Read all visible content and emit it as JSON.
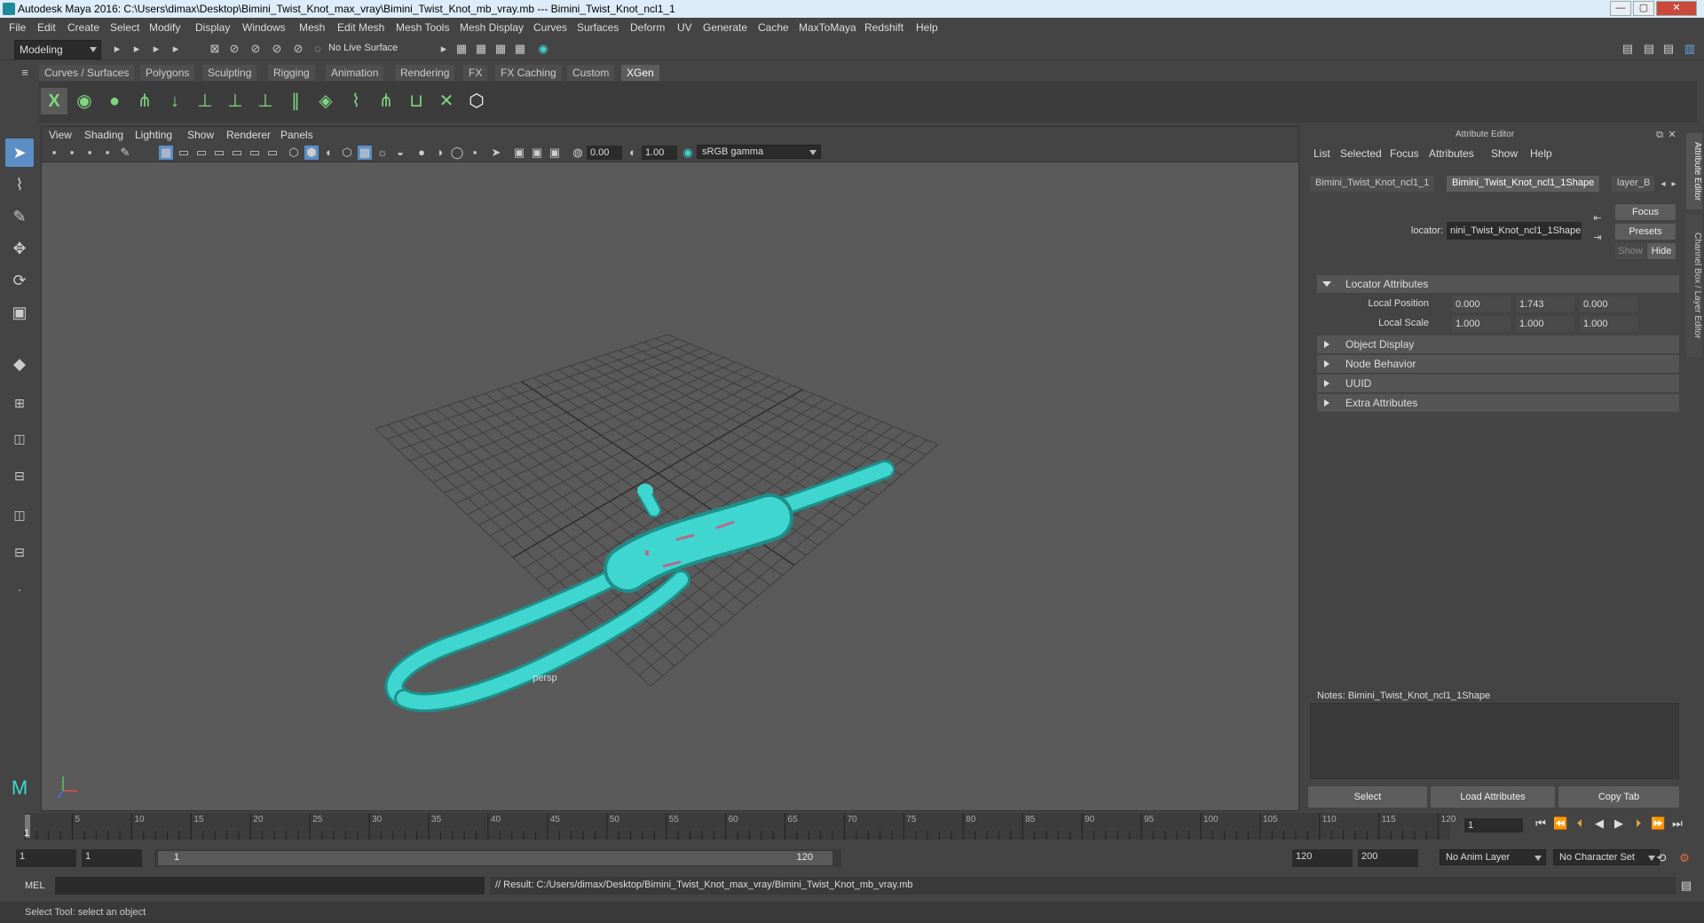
{
  "title_bar": {
    "text": "Autodesk Maya 2016: C:\\Users\\dimax\\Desktop\\Bimini_Twist_Knot_max_vray\\Bimini_Twist_Knot_mb_vray.mb   ---   Bimini_Twist_Knot_ncl1_1",
    "minimize": "—",
    "maximize": "▢",
    "close": "✕"
  },
  "menu": [
    "File",
    "Edit",
    "Create",
    "Select",
    "Modify",
    "Display",
    "Windows",
    "Mesh",
    "Edit Mesh",
    "Mesh Tools",
    "Mesh Display",
    "Curves",
    "Surfaces",
    "Deform",
    "UV",
    "Generate",
    "Cache",
    "MaxToMaya",
    "Redshift",
    "Help"
  ],
  "status_line": {
    "mode": "Modeling",
    "live_surface": "No Live Surface"
  },
  "shelf_tabs": [
    "Curves / Surfaces",
    "Polygons",
    "Sculpting",
    "Rigging",
    "Animation",
    "Rendering",
    "FX",
    "FX Caching",
    "Custom",
    "XGen"
  ],
  "active_shelf_tab": "XGen",
  "viewport": {
    "menu": [
      "View",
      "Shading",
      "Lighting",
      "Show",
      "Renderer",
      "Panels"
    ],
    "exposure": "0.00",
    "gamma": "1.00",
    "color_space": "sRGB gamma",
    "camera_label": "persp"
  },
  "attribute_editor": {
    "title": "Attribute Editor",
    "menu": [
      "List",
      "Selected",
      "Focus",
      "Attributes",
      "Show",
      "Help"
    ],
    "tabs": [
      "Bimini_Twist_Knot_ncl1_1",
      "Bimini_Twist_Knot_ncl1_1Shape",
      "layer_B"
    ],
    "active_tab": "Bimini_Twist_Knot_ncl1_1Shape",
    "node_type_label": "locator:",
    "node_name": "nini_Twist_Knot_ncl1_1Shape",
    "buttons": {
      "focus": "Focus",
      "presets": "Presets",
      "show": "Show",
      "hide": "Hide"
    },
    "sections": [
      {
        "label": "Locator Attributes",
        "expanded": true
      },
      {
        "label": "Object Display",
        "expanded": false
      },
      {
        "label": "Node Behavior",
        "expanded": false
      },
      {
        "label": "UUID",
        "expanded": false
      },
      {
        "label": "Extra Attributes",
        "expanded": false
      }
    ],
    "local_position": {
      "label": "Local Position",
      "values": [
        "0.000",
        "1.743",
        "0.000"
      ]
    },
    "local_scale": {
      "label": "Local Scale",
      "values": [
        "1.000",
        "1.000",
        "1.000"
      ]
    },
    "notes_label": "Notes:  Bimini_Twist_Knot_ncl1_1Shape",
    "bottom_buttons": [
      "Select",
      "Load Attributes",
      "Copy Tab"
    ]
  },
  "side_tabs": {
    "attribute_editor": "Attribute Editor",
    "channel_box": "Channel Box / Layer Editor"
  },
  "time_slider": {
    "ticks": [
      "5",
      "10",
      "15",
      "20",
      "25",
      "30",
      "35",
      "40",
      "45",
      "50",
      "55",
      "60",
      "65",
      "70",
      "75",
      "80",
      "85",
      "90",
      "95",
      "100",
      "105",
      "110",
      "115",
      "120"
    ],
    "start_tick": "1",
    "current_frame": "1"
  },
  "range_slider": {
    "start": "1",
    "playback_start": "1",
    "range_start": "1",
    "range_end": "120",
    "playback_end": "120",
    "end": "200",
    "anim_layer": "No Anim Layer",
    "character_set": "No Character Set"
  },
  "command_line": {
    "lang": "MEL",
    "result": "// Result: C:/Users/dimax/Desktop/Bimini_Twist_Knot_max_vray/Bimini_Twist_Knot_mb_vray.mb"
  },
  "help_line": "Select Tool: select an object",
  "colors": {
    "mesh": "#3fd6d0",
    "active_tab": "#5d5d5d",
    "bg": "#444444",
    "viewport": "#5a5a5a"
  }
}
